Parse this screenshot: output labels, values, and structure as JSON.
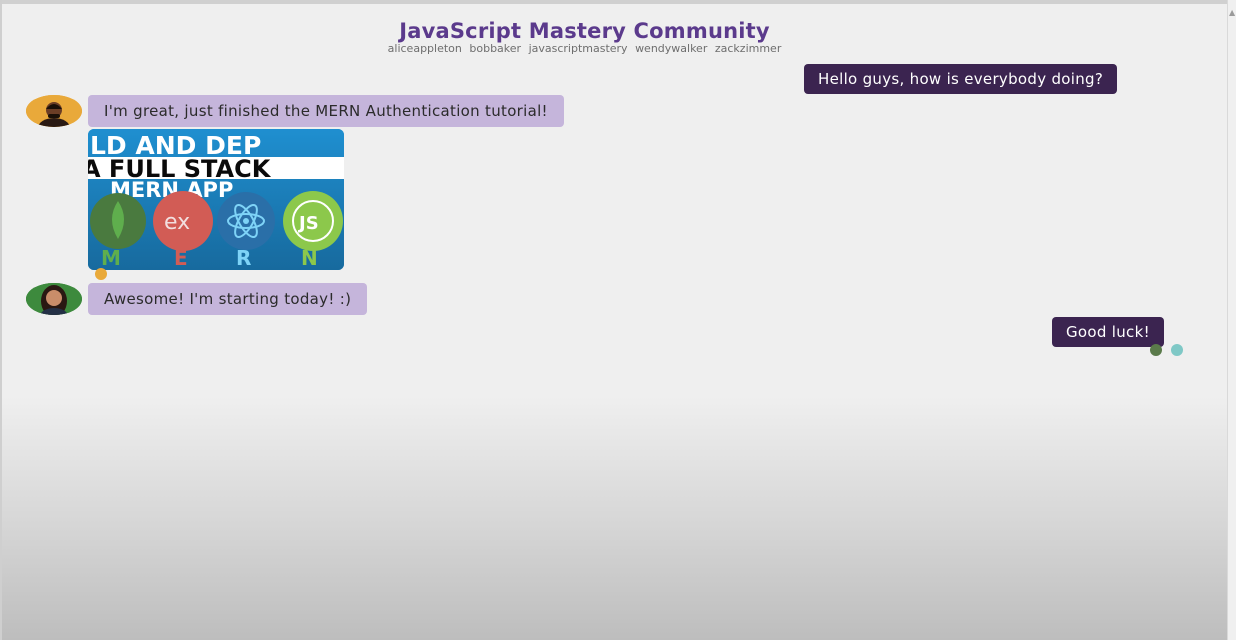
{
  "header": {
    "title": "JavaScript Mastery Community",
    "members": [
      "aliceappleton",
      "bobbaker",
      "javascriptmastery",
      "wendywalker",
      "zackzimmer"
    ]
  },
  "messages": [
    {
      "side": "out",
      "text": "Hello guys, how is everybody doing?"
    },
    {
      "side": "in",
      "avatar": "avatar-man-icon",
      "text": "I'm great, just finished the MERN Authentication tutorial!"
    },
    {
      "side": "in",
      "type": "image",
      "image": {
        "line1": "LD AND DEP",
        "line2": "A FULL STACK",
        "line3": "MERN APP",
        "letters": [
          "M",
          "E",
          "R",
          "N"
        ],
        "logos": [
          "mongodb-leaf-icon",
          "express-icon",
          "react-atom-icon",
          "nodejs-icon"
        ],
        "ex_label": "ex",
        "js_label": "JS"
      }
    },
    {
      "side": "in",
      "avatar": "avatar-woman-icon",
      "text": "Awesome! I'm starting today! :)"
    },
    {
      "side": "out",
      "text": "Good luck!"
    }
  ],
  "colors": {
    "title": "#5b3a8c",
    "outgoing_bubble": "#3b2450",
    "incoming_bubble": "#c5b5db",
    "background": "#efefef"
  }
}
